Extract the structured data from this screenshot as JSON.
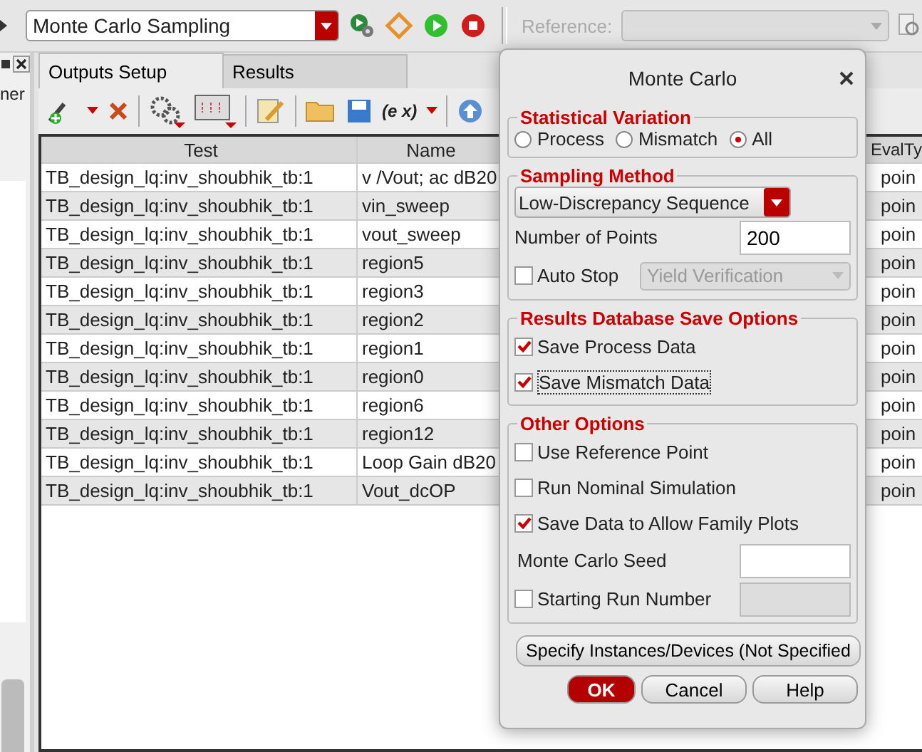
{
  "toolbar": {
    "mode_select": "Monte Carlo Sampling",
    "reference_label": "Reference:"
  },
  "side_panel": {
    "text": "ner"
  },
  "tabs": [
    {
      "label": "Outputs Setup",
      "selected": true
    },
    {
      "label": "Results",
      "selected": false
    }
  ],
  "outputs_toolbar": {
    "expression_button": "(e x)"
  },
  "table": {
    "columns": [
      "Test",
      "Name",
      "EvalTy"
    ],
    "rows": [
      {
        "test": "TB_design_lq:inv_shoubhik_tb:1",
        "name": "v /Vout; ac dB20",
        "evaltype": "poin"
      },
      {
        "test": "TB_design_lq:inv_shoubhik_tb:1",
        "name": "vin_sweep",
        "evaltype": "poin"
      },
      {
        "test": "TB_design_lq:inv_shoubhik_tb:1",
        "name": "vout_sweep",
        "evaltype": "poin"
      },
      {
        "test": "TB_design_lq:inv_shoubhik_tb:1",
        "name": "region5",
        "evaltype": "poin"
      },
      {
        "test": "TB_design_lq:inv_shoubhik_tb:1",
        "name": "region3",
        "evaltype": "poin"
      },
      {
        "test": "TB_design_lq:inv_shoubhik_tb:1",
        "name": "region2",
        "evaltype": "poin"
      },
      {
        "test": "TB_design_lq:inv_shoubhik_tb:1",
        "name": "region1",
        "evaltype": "poin"
      },
      {
        "test": "TB_design_lq:inv_shoubhik_tb:1",
        "name": "region0",
        "evaltype": "poin"
      },
      {
        "test": "TB_design_lq:inv_shoubhik_tb:1",
        "name": "region6",
        "evaltype": "poin"
      },
      {
        "test": "TB_design_lq:inv_shoubhik_tb:1",
        "name": "region12",
        "evaltype": "poin"
      },
      {
        "test": "TB_design_lq:inv_shoubhik_tb:1",
        "name": "Loop Gain dB20",
        "evaltype": "poin"
      },
      {
        "test": "TB_design_lq:inv_shoubhik_tb:1",
        "name": "Vout_dcOP",
        "evaltype": "poin"
      }
    ]
  },
  "dialog": {
    "title": "Monte Carlo",
    "statistical_variation": {
      "title": "Statistical Variation",
      "options": [
        {
          "label": "Process",
          "selected": false
        },
        {
          "label": "Mismatch",
          "selected": false
        },
        {
          "label": "All",
          "selected": true
        }
      ]
    },
    "sampling_method": {
      "title": "Sampling Method",
      "method": "Low-Discrepancy Sequence",
      "points_label": "Number of Points",
      "points_value": "200",
      "auto_stop": {
        "label": "Auto Stop",
        "checked": false
      },
      "auto_stop_mode": "Yield Verification"
    },
    "save_options": {
      "title": "Results Database Save Options",
      "items": [
        {
          "label": "Save Process Data",
          "checked": true
        },
        {
          "label": "Save Mismatch Data",
          "checked": true
        }
      ]
    },
    "other_options": {
      "title": "Other Options",
      "items": [
        {
          "label": "Use Reference Point",
          "checked": false
        },
        {
          "label": "Run Nominal Simulation",
          "checked": false
        },
        {
          "label": "Save Data to Allow Family Plots",
          "checked": true
        }
      ],
      "seed_label": "Monte Carlo Seed",
      "start_run": {
        "label": "Starting Run Number",
        "checked": false
      }
    },
    "specify_button": "Specify Instances/Devices (Not Specified",
    "buttons": [
      "OK",
      "Cancel",
      "Help"
    ]
  }
}
